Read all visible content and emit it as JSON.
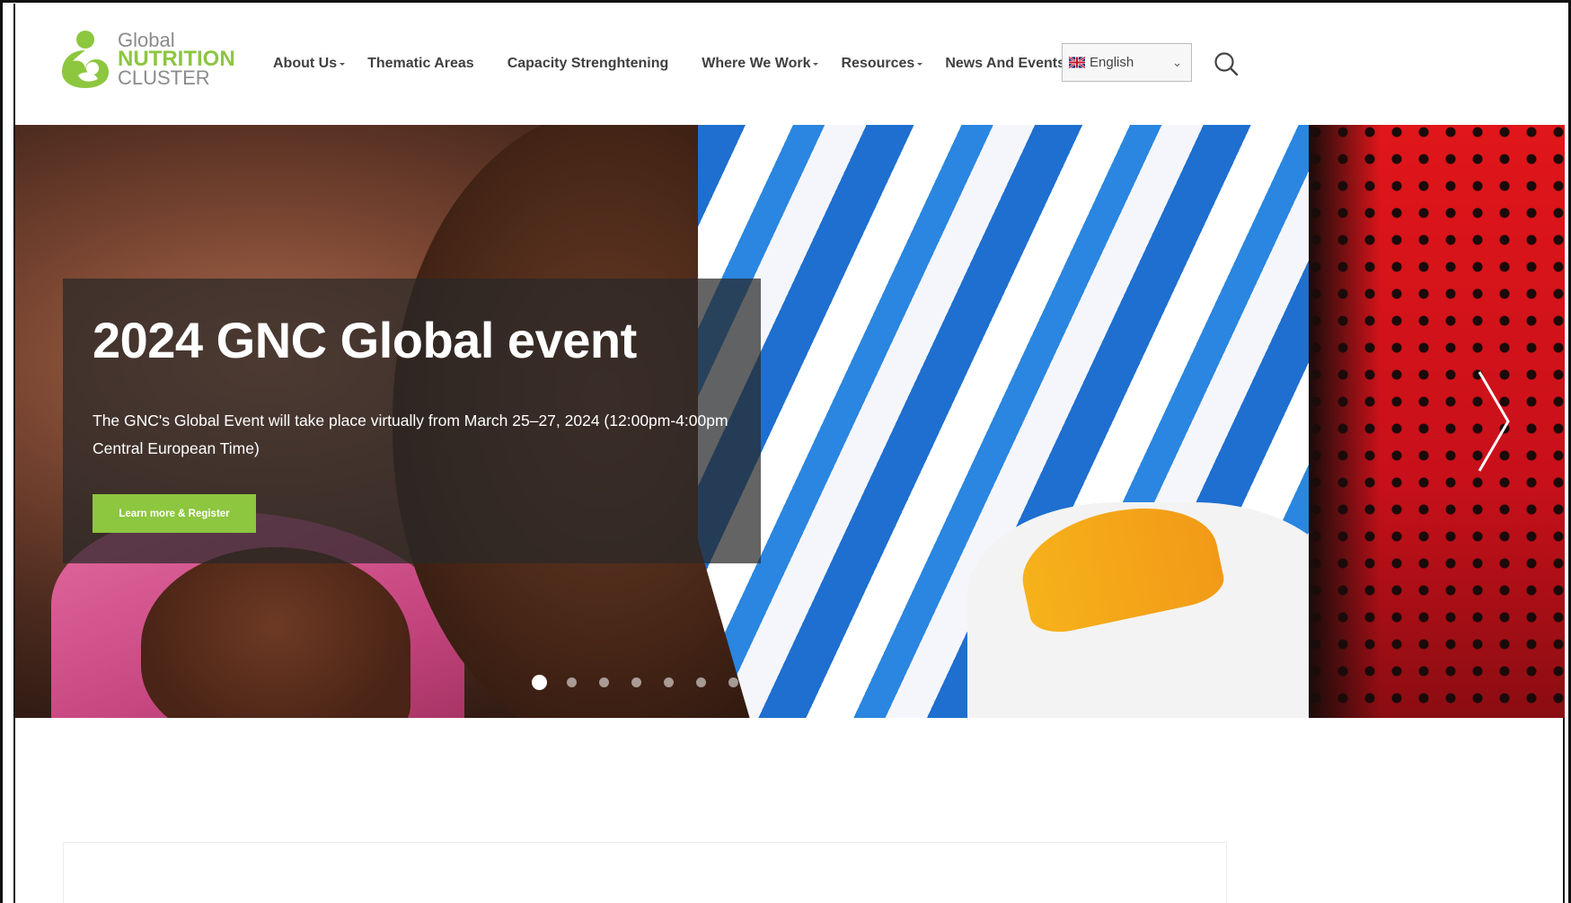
{
  "logo": {
    "line1": "Global",
    "line2": "NUTRITION",
    "line3": "CLUSTER",
    "icon": "mother-child-logo-icon",
    "green": "#8dc63f",
    "grey": "#8b8b8b"
  },
  "nav": {
    "items": [
      {
        "label": "About Us",
        "dropdown": true
      },
      {
        "label": "Thematic Areas",
        "dropdown": false
      },
      {
        "label": "Capacity Strenghtening",
        "dropdown": false
      },
      {
        "label": "Where We Work",
        "dropdown": true
      },
      {
        "label": "Resources",
        "dropdown": true
      },
      {
        "label": "News And Events",
        "dropdown": true
      }
    ],
    "language": {
      "selected": "English",
      "flag_icon": "uk-flag-icon"
    },
    "search_icon": "search-icon"
  },
  "hero": {
    "title": "2024 GNC Global event",
    "description": "The GNC's Global Event will take place virtually from March 25–27, 2024 (12:00pm-4:00pm Central European Time)",
    "cta_label": "Learn more & Register",
    "next_icon": "chevron-right-icon",
    "slide_count": 7,
    "active_slide": 1
  },
  "colors": {
    "accent": "#8dc63f",
    "caption_bg": "rgba(40,40,40,0.72)",
    "nav_text": "#404040"
  }
}
